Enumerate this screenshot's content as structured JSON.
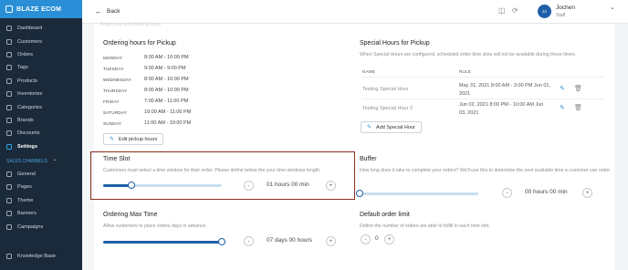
{
  "sidebar": {
    "brand": "BLAZE ECOM",
    "items": [
      {
        "label": "Dashboard",
        "icon": "home-icon"
      },
      {
        "label": "Customers",
        "icon": "users-icon"
      },
      {
        "label": "Orders",
        "icon": "orders-icon"
      },
      {
        "label": "Tags",
        "icon": "tag-icon"
      },
      {
        "label": "Products",
        "icon": "box-icon"
      },
      {
        "label": "Inventories",
        "icon": "inventory-icon"
      },
      {
        "label": "Categories",
        "icon": "category-icon"
      },
      {
        "label": "Brands",
        "icon": "brand-icon"
      },
      {
        "label": "Discounts",
        "icon": "discount-icon"
      },
      {
        "label": "Settings",
        "icon": "gear-icon"
      }
    ],
    "section_label": "SALES CHANNELS",
    "channel_items": [
      {
        "label": "General",
        "icon": "general-icon"
      },
      {
        "label": "Pages",
        "icon": "pages-icon"
      },
      {
        "label": "Theme",
        "icon": "theme-icon"
      },
      {
        "label": "Banners",
        "icon": "banner-icon"
      },
      {
        "label": "Campaigns",
        "icon": "campaign-icon"
      }
    ],
    "knowledge_base": "Knowledge Base"
  },
  "topbar": {
    "back": "Back",
    "user_initials": "JA",
    "user_name": "Jochen",
    "user_role": "Staff"
  },
  "faded_text": "Begin your scheduled pickups",
  "pickup": {
    "title": "Ordering hours for Pickup",
    "days": [
      {
        "day": "MONDAY",
        "hours": "8:00 AM - 10:00 PM"
      },
      {
        "day": "TUESDAY",
        "hours": "9:00 AM - 9:00 PM"
      },
      {
        "day": "WEDNESDAY",
        "hours": "8:00 AM - 10:00 PM"
      },
      {
        "day": "THURSDAY",
        "hours": "8:00 AM - 10:00 PM"
      },
      {
        "day": "FRIDAY",
        "hours": "7:00 AM - 11:00 PM"
      },
      {
        "day": "SATURDAY",
        "hours": "10:00 AM - 11:00 PM"
      },
      {
        "day": "SUNDAY",
        "hours": "11:00 AM - 10:00 PM"
      }
    ],
    "edit_button": "Edit pickup hours"
  },
  "special": {
    "title": "Special Hours for Pickup",
    "description": "When Special Hours are configured, scheduled order time slots will not be available during those times.",
    "col_name": "NAME",
    "col_rule": "RULE",
    "rows": [
      {
        "name": "Testing Special Hour",
        "rule": "May 31, 2021 8:00 AM - 3:00 PM Jun 01, 2021"
      },
      {
        "name": "Testing Special Hour 2",
        "rule": "Jun 02, 2021 8:00 PM - 10:00 AM Jun 03, 2021"
      }
    ],
    "add_button": "Add Special Hour"
  },
  "time_slot": {
    "title": "Time Slot",
    "description": "Customers must select a time window for their order. Please define below the your time windows length.",
    "value": "01 hours 00 min",
    "slider_level": 0.24
  },
  "buffer": {
    "title": "Buffer",
    "description": "How long does it take to complete your orders? We'll use this to determine the next available time a customer can order.",
    "value": "00 hours 00 min",
    "slider_level": 0
  },
  "max_time": {
    "title": "Ordering Max Time",
    "description": "Allow customers to place orders days in advance.",
    "value": "07 days 00 hours",
    "slider_level": 1
  },
  "order_limit": {
    "title": "Default order limit",
    "description": "Define the number of orders are able to fulfill in each time slot.",
    "value": "0"
  },
  "stepper": {
    "minus": "-",
    "plus": "+"
  },
  "colors": {
    "sidebar_bg": "#1b2a3a",
    "brand_bar": "#2a8fd6",
    "slider_fill": "#1f5fa8",
    "highlight_border": "#8b2b1e"
  }
}
